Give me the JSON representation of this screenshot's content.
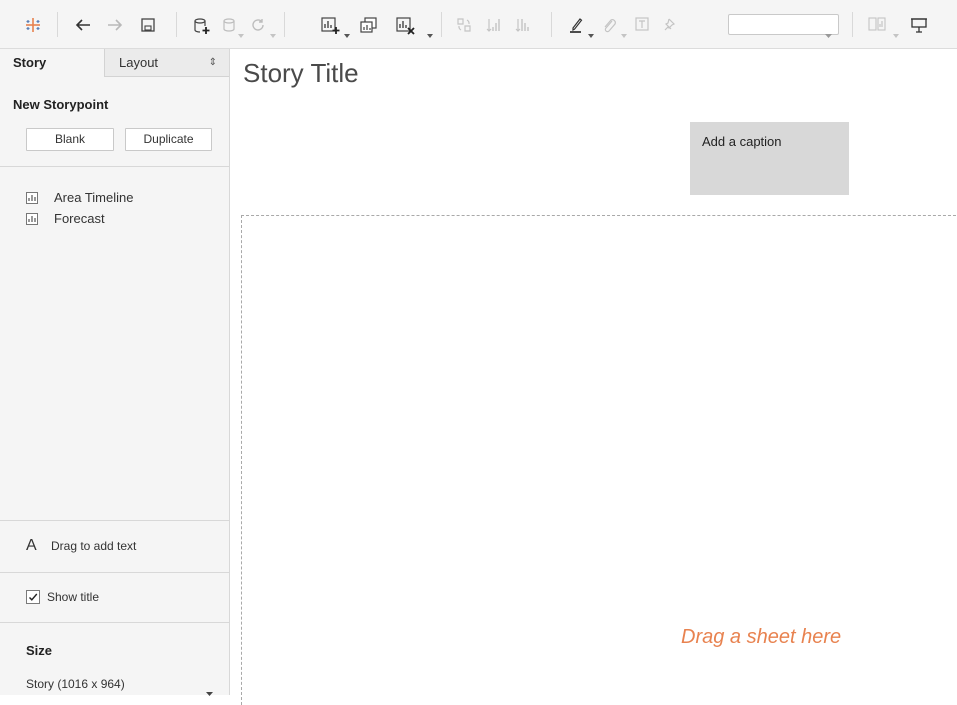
{
  "toolbar": {
    "icons": [
      "tableau-logo-icon",
      "back-icon",
      "forward-icon",
      "save-icon",
      "new-data-source-icon",
      "pause-updates-icon",
      "refresh-icon",
      "new-worksheet-icon",
      "duplicate-icon",
      "clear-sheet-icon",
      "swap-rows-columns-icon",
      "sort-ascending-icon",
      "sort-descending-icon",
      "highlight-icon",
      "group-members-icon",
      "show-mark-labels-icon",
      "fix-axes-icon",
      "fit-select-icon",
      "show-me-icon",
      "presentation-mode-icon"
    ],
    "fit_select_value": ""
  },
  "panel": {
    "tabs": [
      {
        "label": "Story"
      },
      {
        "label": "Layout"
      }
    ],
    "new_storypoint": {
      "title": "New Storypoint",
      "blank_label": "Blank",
      "duplicate_label": "Duplicate"
    },
    "sheets": [
      {
        "label": "Area Timeline",
        "icon": "worksheet-icon"
      },
      {
        "label": "Forecast",
        "icon": "worksheet-icon"
      }
    ],
    "drag_text": {
      "glyph": "A",
      "label": "Drag to add text"
    },
    "show_title": {
      "label": "Show title",
      "checked": true
    },
    "size": {
      "title": "Size",
      "value": "Story (1016 x 964)"
    }
  },
  "story": {
    "title": "Story Title",
    "caption": "Add a caption",
    "drop_hint": "Drag a sheet here"
  },
  "colors": {
    "accent_orange": "#e8824f",
    "panel_bg": "#f5f5f5",
    "caption_bg": "#d8d8d8"
  }
}
